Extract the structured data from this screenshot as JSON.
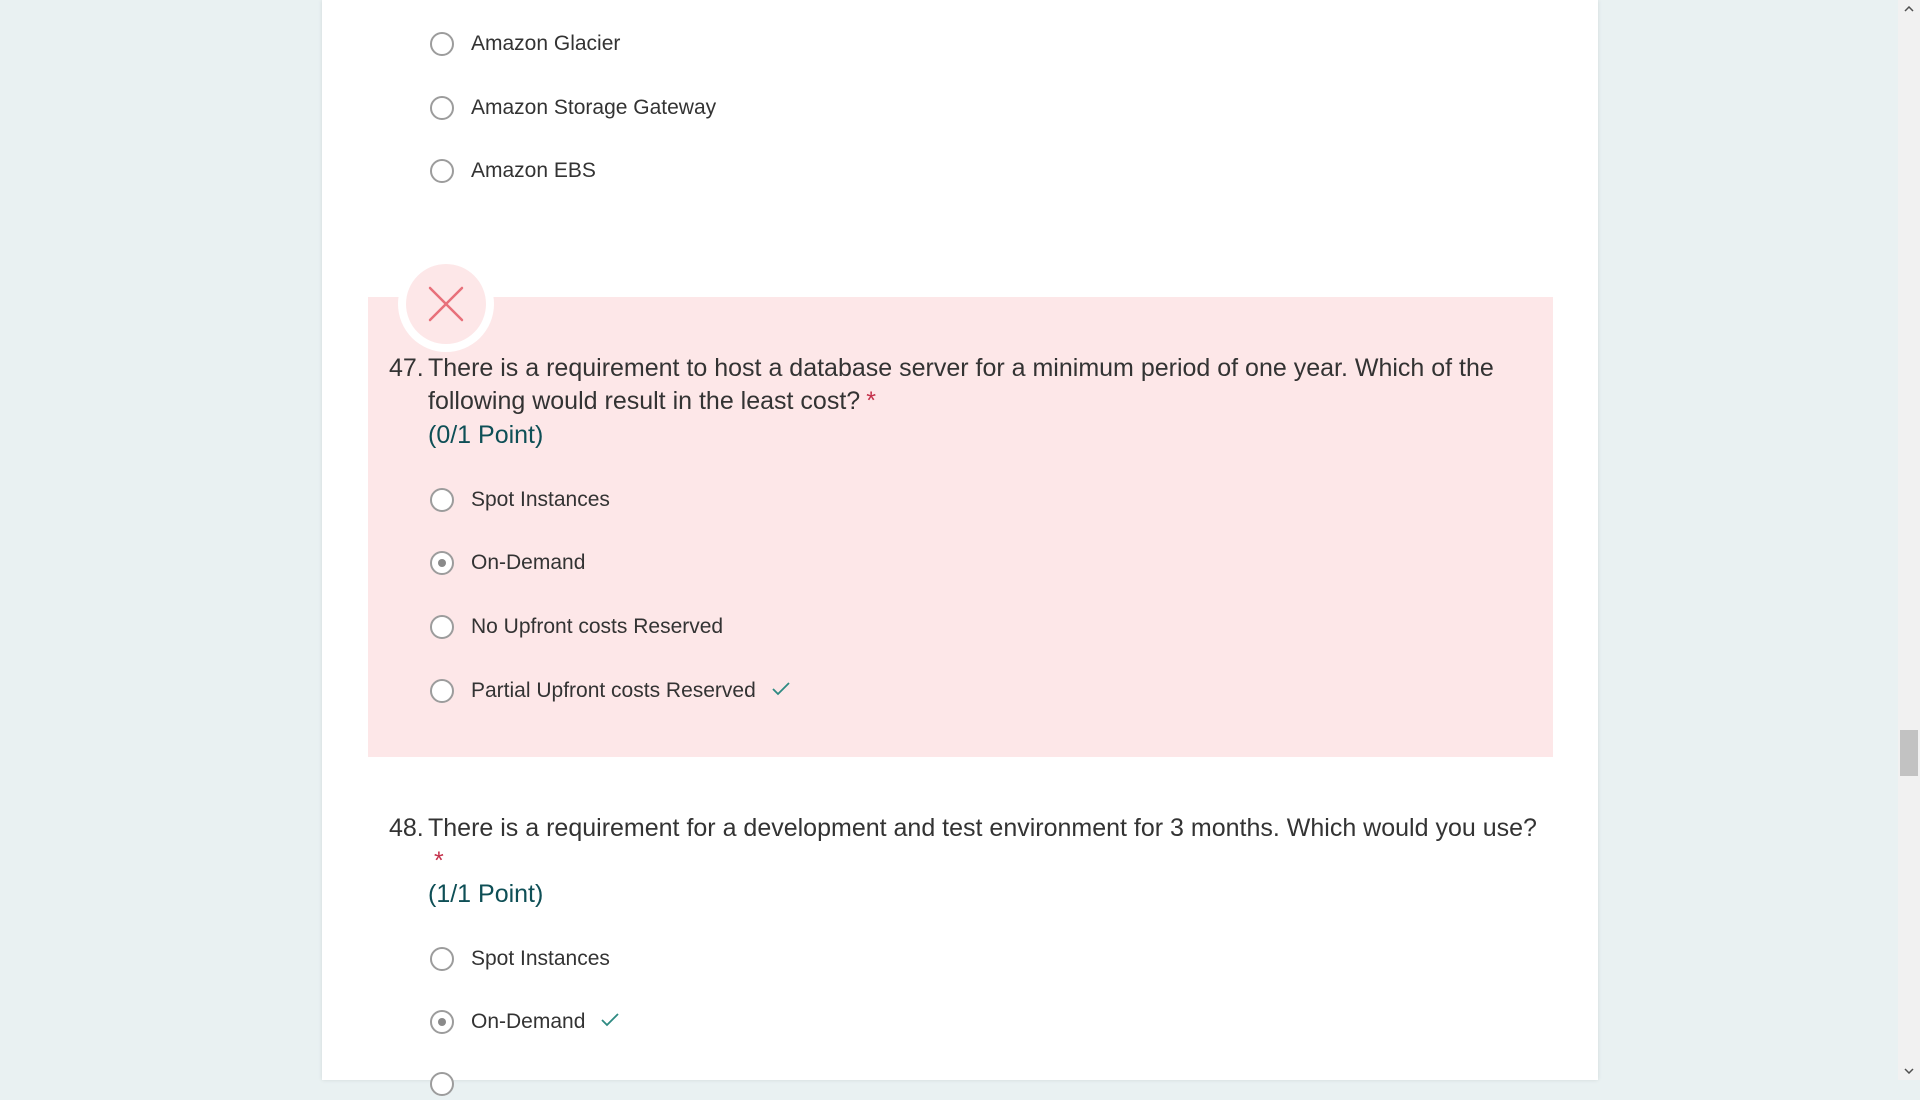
{
  "prev_question": {
    "options": [
      "Amazon Glacier",
      "Amazon Storage Gateway",
      "Amazon EBS"
    ]
  },
  "q47": {
    "number": "47.",
    "text": "There is a requirement to host a database server for a minimum period of one year. Which of the following would result in the least cost?",
    "required": "*",
    "points": "(0/1 Point)",
    "result": "incorrect",
    "options": [
      "Spot Instances",
      "On-Demand",
      "No Upfront costs Reserved",
      "Partial Upfront costs Reserved"
    ],
    "selected": "On-Demand",
    "correct": "Partial Upfront costs Reserved"
  },
  "q48": {
    "number": "48.",
    "text": "There is a requirement for a development and test environment for 3 months. Which would you use?",
    "required": "*",
    "points": "(1/1 Point)",
    "result": "correct",
    "options": [
      "Spot Instances",
      "On-Demand"
    ],
    "selected": "On-Demand",
    "correct": "On-Demand"
  },
  "colors": {
    "background": "#e9f1f2",
    "card": "#ffffff",
    "incorrect_highlight": "#fde7e8",
    "incorrect_icon": "#e8707a",
    "points_text": "#0e4f56",
    "required_star": "#c4314b",
    "correct_check": "#2e8a82"
  },
  "icons": {
    "incorrect_badge": "close-icon",
    "correct_answer": "checkmark-icon",
    "scroll_up": "chevron-up-icon",
    "scroll_down": "chevron-down-icon"
  }
}
